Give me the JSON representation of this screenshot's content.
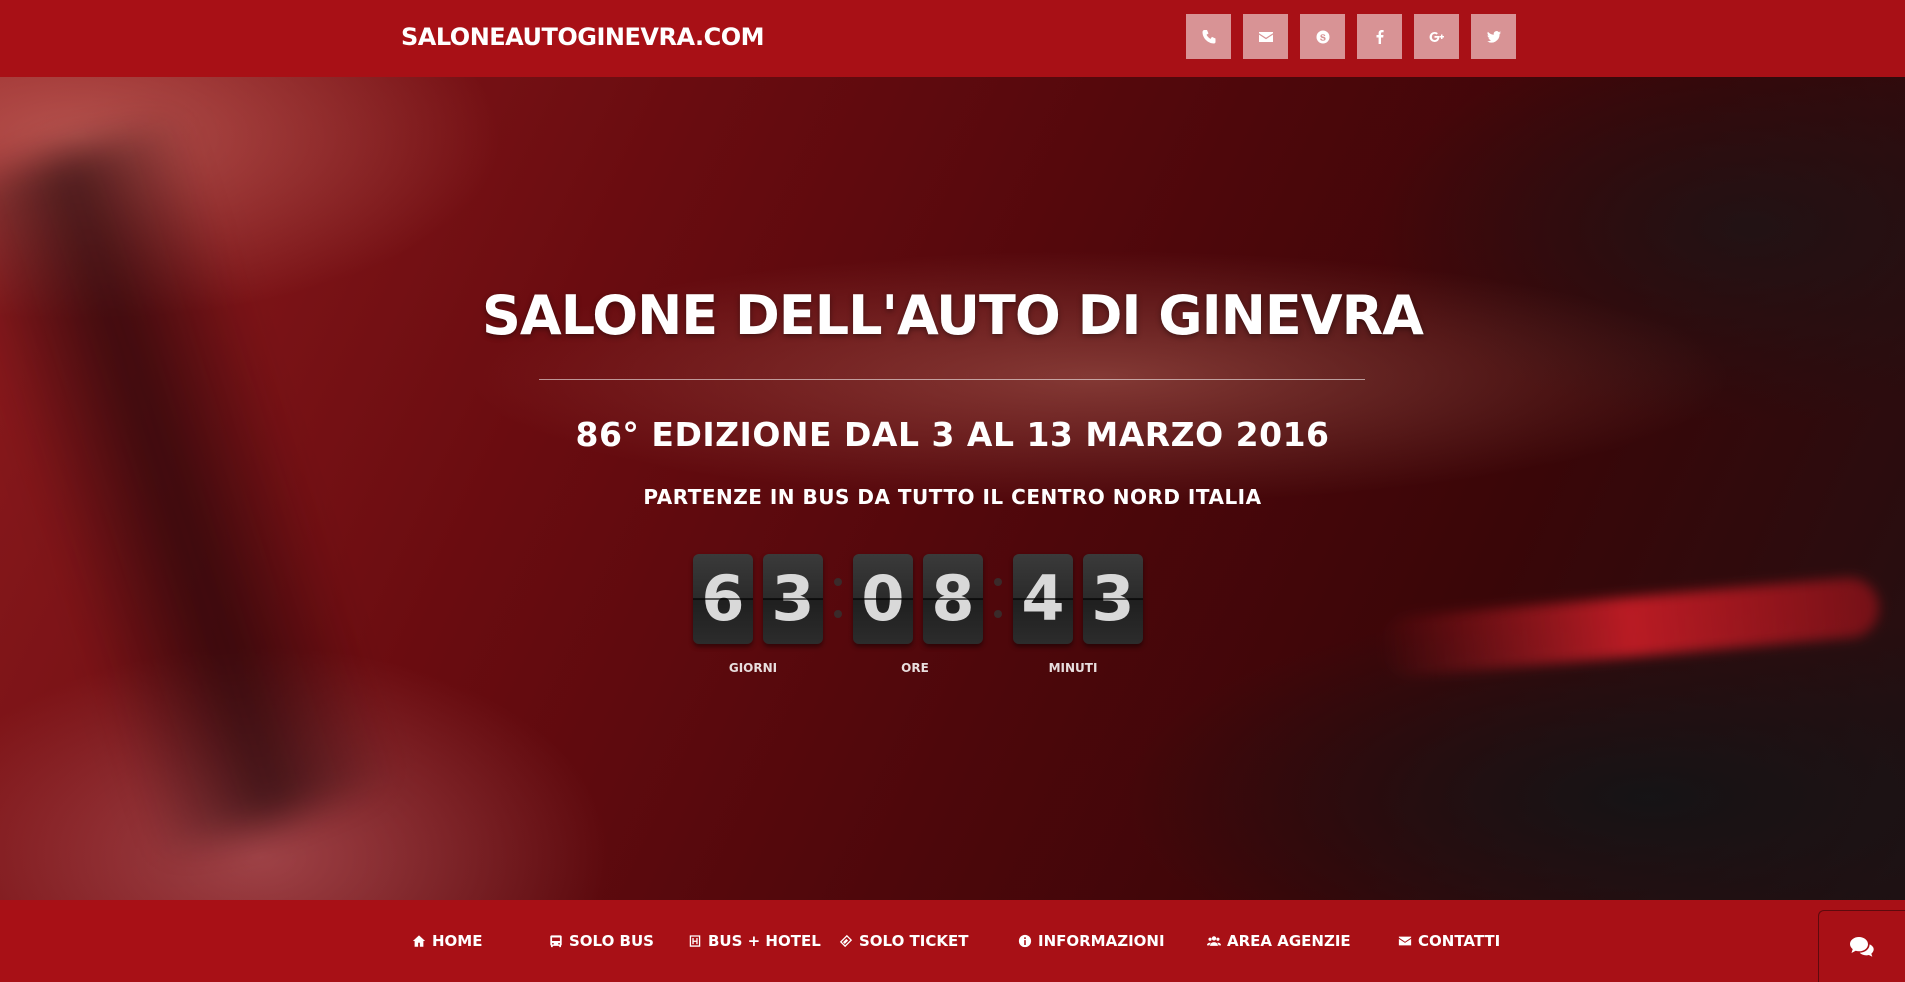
{
  "header": {
    "brand": "SALONEAUTOGINEVRA.COM",
    "social_icons": [
      "phone-icon",
      "envelope-icon",
      "skype-icon",
      "facebook-icon",
      "google-plus-icon",
      "twitter-icon"
    ]
  },
  "hero": {
    "title": "SALONE DELL'AUTO DI GINEVRA",
    "subtitle": "86° EDIZIONE DAL 3 AL 13 MARZO 2016",
    "tagline": "PARTENZE IN BUS DA TUTTO IL CENTRO NORD ITALIA"
  },
  "countdown": {
    "days": [
      "6",
      "3"
    ],
    "hours": [
      "0",
      "8"
    ],
    "minutes": [
      "4",
      "3"
    ],
    "labels": {
      "days": "GIORNI",
      "hours": "ORE",
      "minutes": "MINUTI"
    }
  },
  "nav": {
    "items": [
      {
        "label": "HOME",
        "icon": "home-icon"
      },
      {
        "label": "SOLO BUS",
        "icon": "bus-icon"
      },
      {
        "label": "BUS + HOTEL",
        "icon": "hotel-icon"
      },
      {
        "label": "SOLO TICKET",
        "icon": "ticket-icon"
      },
      {
        "label": "INFORMAZIONI",
        "icon": "info-icon"
      },
      {
        "label": "AREA AGENZIE",
        "icon": "users-icon"
      },
      {
        "label": "CONTATTI",
        "icon": "envelope-icon"
      }
    ]
  },
  "colors": {
    "bar_red": "#a81016",
    "digit_bg": "#2b2b2b",
    "digit_text": "#d9d9d9"
  },
  "chat": {
    "icon": "chat-bubbles-icon"
  }
}
